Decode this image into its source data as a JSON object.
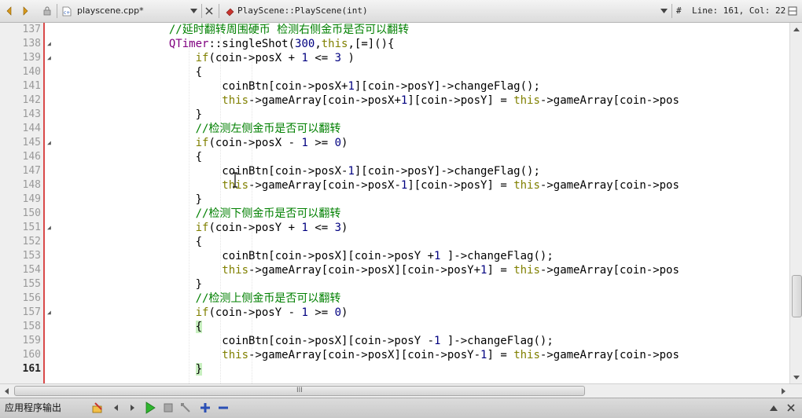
{
  "toolbar": {
    "file_name": "playscene.cpp*",
    "symbol": "PlayScene::PlayScene(int)",
    "position": "Line: 161, Col: 22",
    "hash_label": "#"
  },
  "colors": {
    "keyword": "#808000",
    "comment": "#008000",
    "number": "#000080",
    "type": "#800080",
    "plain": "#000000",
    "gutter_marker": "#d94a4a"
  },
  "editor": {
    "current_line": "161",
    "lines": [
      {
        "num": "137",
        "fold": "",
        "code": "                //延时翻转周围硬币 检测右侧金币是否可以翻转"
      },
      {
        "num": "138",
        "fold": "◢",
        "code": "                QTimer::singleShot(300,this,[=](){"
      },
      {
        "num": "139",
        "fold": "◢",
        "code": "                    if(coin->posX + 1 <= 3 )"
      },
      {
        "num": "140",
        "fold": "",
        "code": "                    {"
      },
      {
        "num": "141",
        "fold": "",
        "code": "                        coinBtn[coin->posX+1][coin->posY]->changeFlag();"
      },
      {
        "num": "142",
        "fold": "",
        "code": "                        this->gameArray[coin->posX+1][coin->posY] = this->gameArray[coin->pos"
      },
      {
        "num": "143",
        "fold": "",
        "code": "                    }"
      },
      {
        "num": "144",
        "fold": "",
        "code": "                    //检测左侧金币是否可以翻转"
      },
      {
        "num": "145",
        "fold": "◢",
        "code": "                    if(coin->posX - 1 >= 0)"
      },
      {
        "num": "146",
        "fold": "",
        "code": "                    {"
      },
      {
        "num": "147",
        "fold": "",
        "code": "                        coinBtn[coin->posX-1][coin->posY]->changeFlag();"
      },
      {
        "num": "148",
        "fold": "",
        "code": "                        this->gameArray[coin->posX-1][coin->posY] = this->gameArray[coin->pos"
      },
      {
        "num": "149",
        "fold": "",
        "code": "                    }"
      },
      {
        "num": "150",
        "fold": "",
        "code": "                    //检测下侧金币是否可以翻转"
      },
      {
        "num": "151",
        "fold": "◢",
        "code": "                    if(coin->posY + 1 <= 3)"
      },
      {
        "num": "152",
        "fold": "",
        "code": "                    {"
      },
      {
        "num": "153",
        "fold": "",
        "code": "                        coinBtn[coin->posX][coin->posY +1 ]->changeFlag();"
      },
      {
        "num": "154",
        "fold": "",
        "code": "                        this->gameArray[coin->posX][coin->posY+1] = this->gameArray[coin->pos"
      },
      {
        "num": "155",
        "fold": "",
        "code": "                    }"
      },
      {
        "num": "156",
        "fold": "",
        "code": "                    //检测上侧金币是否可以翻转"
      },
      {
        "num": "157",
        "fold": "◢",
        "code": "                    if(coin->posY - 1 >= 0)"
      },
      {
        "num": "158",
        "fold": "",
        "code": "                    {"
      },
      {
        "num": "159",
        "fold": "",
        "code": "                        coinBtn[coin->posX][coin->posY -1 ]->changeFlag();"
      },
      {
        "num": "160",
        "fold": "",
        "code": "                        this->gameArray[coin->posX][coin->posY-1] = this->gameArray[coin->pos"
      },
      {
        "num": "161",
        "fold": "",
        "code": "                    }"
      }
    ]
  },
  "output_bar": {
    "title": "应用程序输出"
  },
  "scrollbars": {
    "h_grip": "III"
  }
}
